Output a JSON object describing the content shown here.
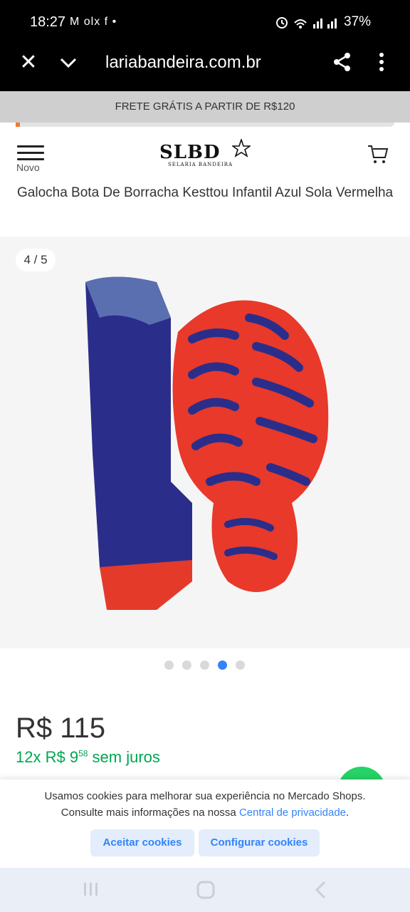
{
  "status_bar": {
    "time": "18:27",
    "notif_icons": "M olx f •",
    "battery": "37%"
  },
  "browser": {
    "url": "lariabandeira.com.br"
  },
  "shipping_banner": "FRETE GRÁTIS A PARTIR DE R$120",
  "shipping_progress": 0.01,
  "header": {
    "menu_label": "Novo",
    "logo_text": "SLBD",
    "logo_subtext": "SELARIA BANDEIRA"
  },
  "product": {
    "title": "Galocha Bota De Borracha Kesttou Infantil Azul Sola Vermelha",
    "image_counter": "4 / 5",
    "image_count": 5,
    "active_image_index": 4,
    "price": "R$ 115",
    "installments_prefix": "12x R$ 9",
    "installments_cents": "58",
    "installments_suffix": "sem juros"
  },
  "cookie_banner": {
    "message_line1": "Usamos cookies para melhorar sua experiência no Mercado Shops.",
    "message_line2_prefix": "Consulte mais informações na nossa",
    "privacy_link": "Central de privacidade",
    "message_line2_suffix": ".",
    "accept_label": "Aceitar cookies",
    "configure_label": "Configurar cookies"
  },
  "colors": {
    "accent_blue": "#3483fa",
    "installments_green": "#00a650",
    "progress_orange": "#f37a2b"
  },
  "icons": [
    "close-icon",
    "chevron-down-icon",
    "share-icon",
    "more-vert-icon",
    "menu-icon",
    "cart-icon",
    "chat-icon",
    "recents-nav-icon",
    "home-nav-icon",
    "back-nav-icon"
  ]
}
